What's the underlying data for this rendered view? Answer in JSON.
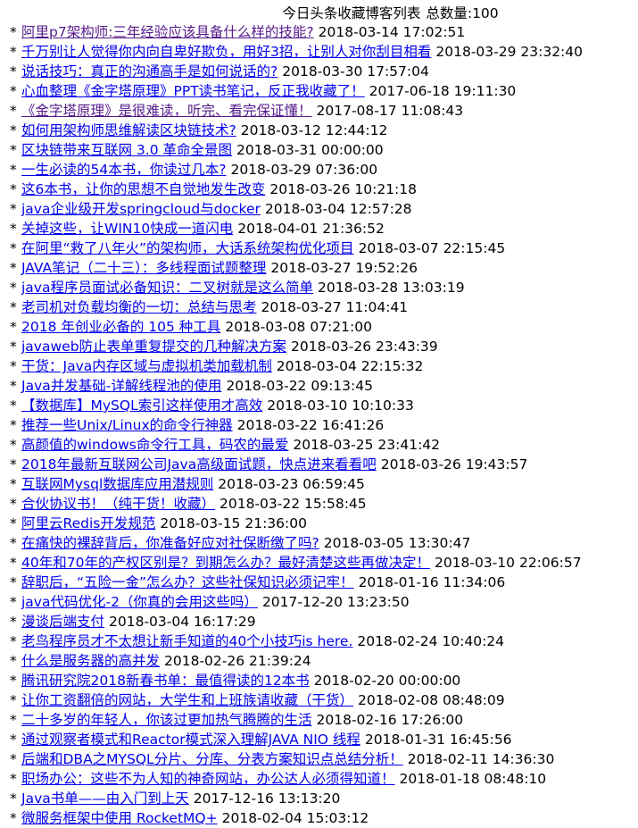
{
  "page": {
    "title": "今日头条收藏博客列表",
    "count_label": "总数量:100"
  },
  "bullet": "*",
  "colors": {
    "link": "#0000ee",
    "visited_link": "#551a8b",
    "text": "#000000",
    "background": "#ffffff"
  },
  "articles": [
    {
      "title": "阿里p7架构师:三年经验应该具备什么样的技能?",
      "date": "2018-03-14 17:02:51",
      "visited": true
    },
    {
      "title": "千万别让人觉得你内向自卑好欺负，用好3招，让别人对你刮目相看",
      "date": "2018-03-29 23:32:40",
      "visited": false
    },
    {
      "title": "说话技巧：真正的沟通高手是如何说话的?",
      "date": "2018-03-30 17:57:04",
      "visited": false
    },
    {
      "title": "心血整理《金字塔原理》PPT读书笔记，反正我收藏了！",
      "date": "2017-06-18 19:11:30",
      "visited": false
    },
    {
      "title": "《金字塔原理》是很难读，听完、看完保证懂！",
      "date": "2017-08-17 11:08:43",
      "visited": true
    },
    {
      "title": "如何用架构师思维解读区块链技术?",
      "date": "2018-03-12 12:44:12",
      "visited": false
    },
    {
      "title": "区块链带来互联网 3.0 革命全景图",
      "date": "2018-03-31 00:00:00",
      "visited": false
    },
    {
      "title": "一生必读的54本书，你读过几本?",
      "date": "2018-03-29 07:36:00",
      "visited": false
    },
    {
      "title": "这6本书，让你的思想不自觉地发生改变",
      "date": "2018-03-26 10:21:18",
      "visited": false
    },
    {
      "title": "java企业级开发springcloud与docker",
      "date": "2018-03-04 12:57:28",
      "visited": false
    },
    {
      "title": "关掉这些，让WIN10快成一道闪电",
      "date": "2018-04-01 21:36:52",
      "visited": false
    },
    {
      "title": "在阿里“救了八年火”的架构师，大话系统架构优化项目",
      "date": "2018-03-07 22:15:45",
      "visited": false
    },
    {
      "title": "JAVA笔记（二十三）：多线程面试题整理",
      "date": "2018-03-27 19:52:26",
      "visited": false
    },
    {
      "title": "java程序员面试必备知识：二叉树就是这么简单",
      "date": "2018-03-28 13:03:19",
      "visited": false
    },
    {
      "title": "老司机对负载均衡的一切：总结与思考",
      "date": "2018-03-27 11:04:41",
      "visited": false
    },
    {
      "title": "2018 年创业必备的 105 种工具",
      "date": "2018-03-08 07:21:00",
      "visited": false
    },
    {
      "title": "javaweb防止表单重复提交的几种解决方案",
      "date": "2018-03-26 23:43:39",
      "visited": false
    },
    {
      "title": "干货：Java内存区域与虚拟机类加载机制",
      "date": "2018-03-04 22:15:32",
      "visited": false
    },
    {
      "title": "Java并发基础-详解线程池的使用",
      "date": "2018-03-22 09:13:45",
      "visited": false
    },
    {
      "title": "【数据库】MySQL索引这样使用才高效",
      "date": "2018-03-10 10:10:33",
      "visited": false
    },
    {
      "title": "推荐一些Unix/Linux的命令行神器",
      "date": "2018-03-22 16:41:26",
      "visited": false
    },
    {
      "title": "高颜值的windows命令行工具，码农的最爱",
      "date": "2018-03-25 23:41:42",
      "visited": false
    },
    {
      "title": "2018年最新互联网公司Java高级面试题，快点进来看看吧",
      "date": "2018-03-26 19:43:57",
      "visited": false
    },
    {
      "title": "互联网Mysql数据库应用潜规则",
      "date": "2018-03-23 06:59:45",
      "visited": false
    },
    {
      "title": "合伙协议书！（纯干货！收藏）",
      "date": "2018-03-22 15:58:45",
      "visited": false
    },
    {
      "title": "阿里云Redis开发规范",
      "date": "2018-03-15 21:36:00",
      "visited": false
    },
    {
      "title": "在痛快的裸辞背后，你准备好应对社保断缴了吗?",
      "date": "2018-03-05 13:30:47",
      "visited": false
    },
    {
      "title": "40年和70年的产权区别是？到期怎么办？最好清楚这些再做决定！",
      "date": "2018-03-10 22:06:57",
      "visited": false
    },
    {
      "title": "辞职后，“五险一金”怎么办？这些社保知识必须记牢！",
      "date": "2018-01-16 11:34:06",
      "visited": false
    },
    {
      "title": "java代码优化-2（你真的会用这些吗）",
      "date": "2017-12-20 13:23:50",
      "visited": false
    },
    {
      "title": "漫谈后端支付",
      "date": "2018-03-04 16:17:29",
      "visited": false
    },
    {
      "title": "老鸟程序员才不太想让新手知道的40个小技巧is here.",
      "date": "2018-02-24 10:40:24",
      "visited": false
    },
    {
      "title": "什么是服务器的高并发",
      "date": "2018-02-26 21:39:24",
      "visited": false
    },
    {
      "title": "腾讯研究院2018新春书单：最值得读的12本书",
      "date": "2018-02-20 00:00:00",
      "visited": false
    },
    {
      "title": "让你工资翻倍的网站，大学生和上班族请收藏（干货）",
      "date": "2018-02-08 08:48:09",
      "visited": false
    },
    {
      "title": "二十多岁的年轻人，你该过更加热气腾腾的生活",
      "date": "2018-02-16 17:26:00",
      "visited": false
    },
    {
      "title": "通过观察者模式和Reactor模式深入理解JAVA NIO 线程",
      "date": "2018-01-31 16:45:56",
      "visited": false
    },
    {
      "title": "后端和DBA之MYSQL分片、分库、分表方案知识点总结分析！",
      "date": "2018-02-11 14:36:30",
      "visited": false
    },
    {
      "title": "职场办公：这些不为人知的神奇网站，办公达人必须得知道！",
      "date": "2018-01-18 08:48:10",
      "visited": false
    },
    {
      "title": "Java书单——由入门到上天",
      "date": "2017-12-16 13:13:20",
      "visited": false
    },
    {
      "title": "微服务框架中使用 RocketMQ+",
      "date": "2018-02-04 15:03:12",
      "visited": false
    }
  ]
}
